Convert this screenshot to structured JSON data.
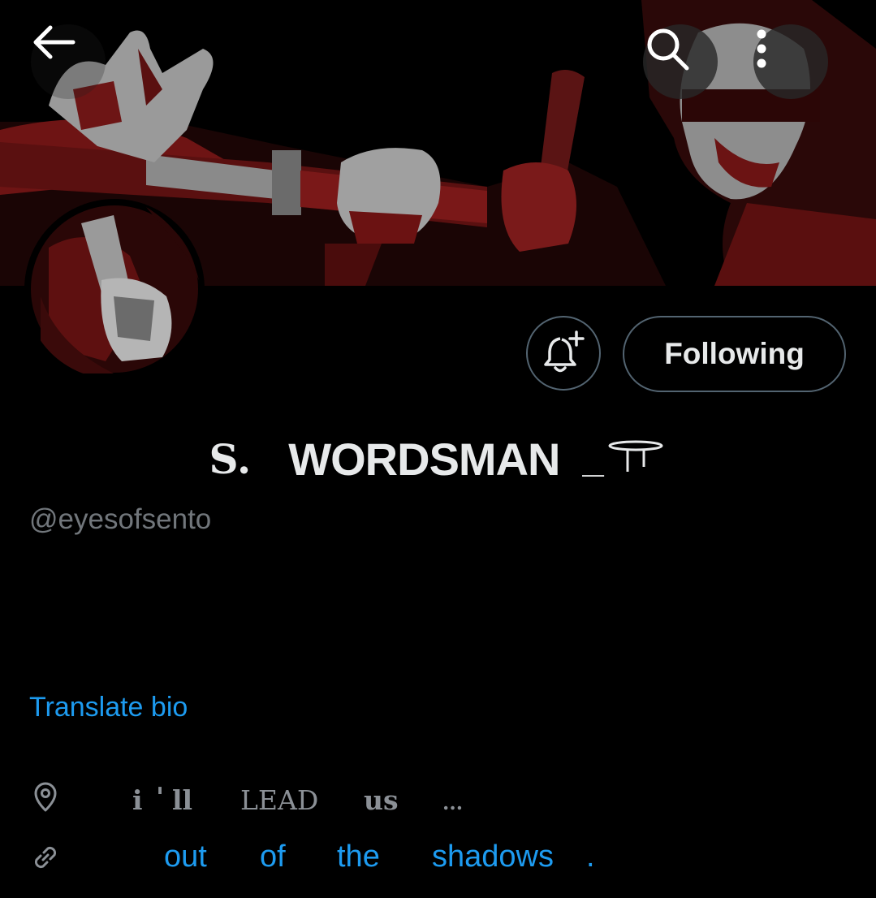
{
  "header": {
    "back_icon": "arrow-left-icon",
    "search_icon": "search-icon",
    "more_icon": "more-vertical-icon"
  },
  "profile": {
    "name_prefix": "S.",
    "name_main": "WORDSMAN",
    "name_suffix": "_",
    "handle": "@eyesofsento",
    "translate_bio": "Translate bio"
  },
  "actions": {
    "notify_icon": "bell-plus-icon",
    "following_label": "Following"
  },
  "location": {
    "icon": "location-pin-icon",
    "words": [
      "i",
      "'",
      "ll",
      "LEAD",
      "us",
      "..."
    ]
  },
  "website": {
    "icon": "link-icon",
    "words": [
      "out",
      "of",
      "the",
      "shadows",
      "."
    ]
  },
  "colors": {
    "background": "#000000",
    "accent_blue": "#1d9bf0",
    "muted": "#71767b",
    "border": "#536471",
    "banner_red": "#7a1a1a"
  }
}
